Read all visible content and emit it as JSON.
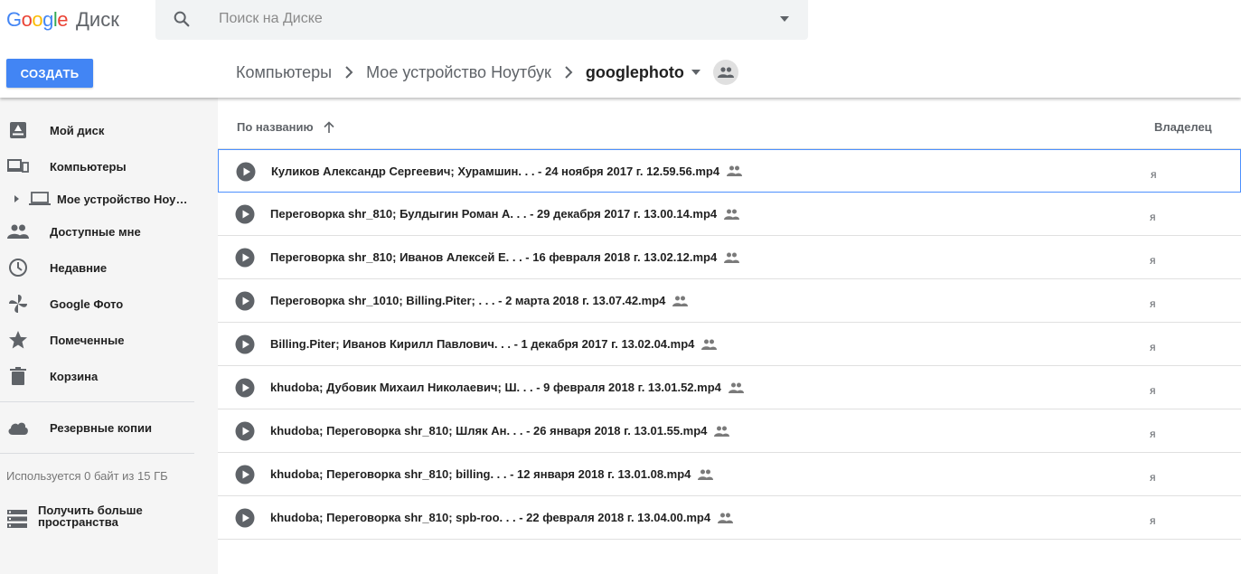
{
  "header": {
    "logo_google": "Google",
    "logo_product": "Диск",
    "search_placeholder": "Поиск на Диске",
    "create_label": "СОЗДАТЬ"
  },
  "breadcrumb": {
    "items": [
      "Компьютеры",
      "Мое устройство Ноутбук"
    ],
    "current": "googlephoto"
  },
  "sidebar": {
    "items": [
      {
        "label": "Мой диск",
        "icon": "drive-icon"
      },
      {
        "label": "Компьютеры",
        "icon": "computers-icon"
      },
      {
        "label": "Мое устройство Ноутбук",
        "icon": "laptop-icon"
      },
      {
        "label": "Доступные мне",
        "icon": "people-icon"
      },
      {
        "label": "Недавние",
        "icon": "clock-icon"
      },
      {
        "label": "Google Фото",
        "icon": "pinwheel-icon"
      },
      {
        "label": "Помеченные",
        "icon": "star-icon"
      },
      {
        "label": "Корзина",
        "icon": "trash-icon"
      },
      {
        "label": "Резервные копии",
        "icon": "cloud-icon"
      }
    ],
    "storage_text": "Используется 0 байт из 15 ГБ",
    "more_space_label": "Получить больше пространства"
  },
  "list": {
    "sort_label": "По названию",
    "owner_header": "Владелец",
    "rows": [
      {
        "name": "Куликов Александр Сергеевич; Хурамшин. . . - 24 ноября 2017 г. 12.59.56.mp4",
        "owner": "я"
      },
      {
        "name": "Переговорка shr_810; Булдыгин Роман А. . . - 29 декабря 2017 г. 13.00.14.mp4",
        "owner": "я"
      },
      {
        "name": "Переговорка shr_810; Иванов Алексей Е. . . - 16 февраля 2018 г. 13.02.12.mp4",
        "owner": "я"
      },
      {
        "name": "Переговорка shr_1010; Billing.Piter; . . . - 2 марта 2018 г. 13.07.42.mp4",
        "owner": "я"
      },
      {
        "name": "Billing.Piter; Иванов Кирилл Павлович. . . - 1 декабря 2017 г. 13.02.04.mp4",
        "owner": "я"
      },
      {
        "name": "khudoba; Дубовик Михаил Николаевич; Ш. . . - 9 февраля 2018 г. 13.01.52.mp4",
        "owner": "я"
      },
      {
        "name": "khudoba; Переговорка shr_810; Шляк Ан. . . - 26 января 2018 г. 13.01.55.mp4",
        "owner": "я"
      },
      {
        "name": "khudoba; Переговорка shr_810; billing. . . - 12 января 2018 г. 13.01.08.mp4",
        "owner": "я"
      },
      {
        "name": "khudoba; Переговорка shr_810; spb-roo. . . - 22 февраля 2018 г. 13.04.00.mp4",
        "owner": "я"
      }
    ]
  },
  "colors": {
    "accent": "#4285f4",
    "selection_border": "#4d90fe",
    "sidebar_bg": "#f5f5f5"
  }
}
